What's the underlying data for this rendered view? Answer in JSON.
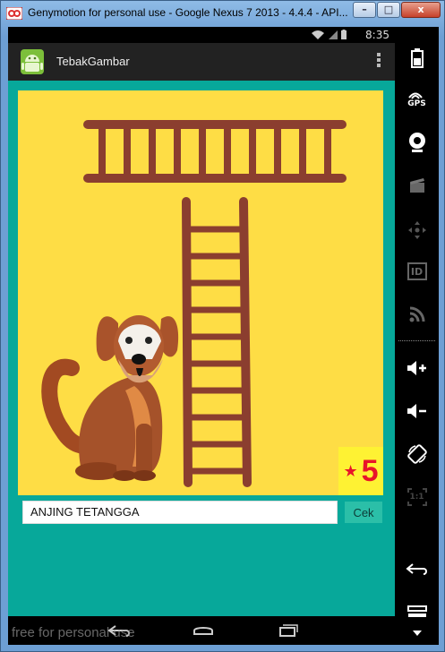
{
  "window": {
    "title": "Genymotion for personal use - Google Nexus 7 2013 - 4.4.4 - API...",
    "minimize_label": "–",
    "maximize_label": "□",
    "close_label": "x"
  },
  "status_bar": {
    "time": "8:35"
  },
  "action_bar": {
    "app_title": "TebakGambar"
  },
  "game": {
    "score": "5",
    "answer_value": "ANJING TETANGGA",
    "check_label": "Cek"
  },
  "sidebar": {
    "gps_label": "GPS",
    "id_label": "ID",
    "pixel_label": "1:1"
  },
  "watermark": "free for personal use",
  "colors": {
    "content_bg": "#07a89a",
    "picture_bg": "#fedd45",
    "ladder": "#8b3e2f",
    "score_bg": "#fef233",
    "score_fg": "#e8142a",
    "button_bg": "#2bbfa8"
  },
  "icons": [
    "genymotion-logo",
    "wifi-icon",
    "signal-icon",
    "battery-icon",
    "android-app-icon",
    "overflow-menu-icon",
    "back-icon",
    "home-icon",
    "recents-icon",
    "gps-icon",
    "webcam-icon",
    "clapper-icon",
    "dpad-icon",
    "id-icon",
    "rss-icon",
    "volume-up-icon",
    "volume-down-icon",
    "rotate-icon",
    "pixel-perfect-icon"
  ]
}
